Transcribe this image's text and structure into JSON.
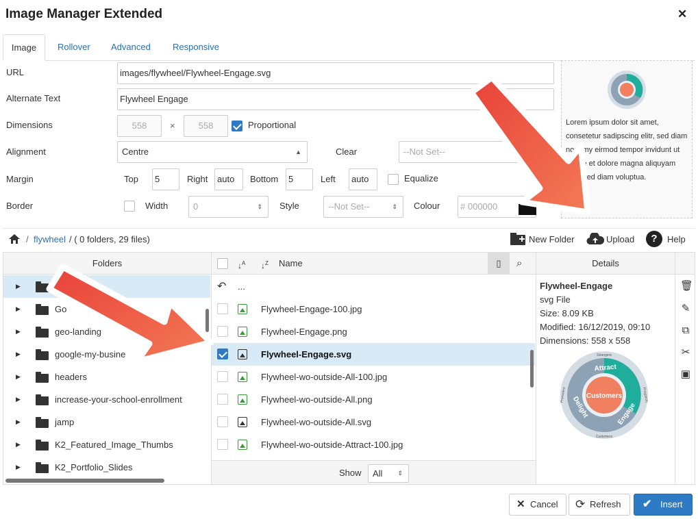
{
  "dialog": {
    "title": "Image Manager Extended",
    "close_icon": "close-icon"
  },
  "tabs": [
    {
      "label": "Image"
    },
    {
      "label": "Rollover"
    },
    {
      "label": "Advanced"
    },
    {
      "label": "Responsive"
    }
  ],
  "form": {
    "url_label": "URL",
    "url_value": "images/flywheel/Flywheel-Engage.svg",
    "alt_label": "Alternate Text",
    "alt_value": "Flywheel Engage",
    "dimensions_label": "Dimensions",
    "width_value": "558",
    "times": "×",
    "height_value": "558",
    "proportional_label": "Proportional",
    "alignment_label": "Alignment",
    "alignment_value": "Centre",
    "clear_label": "Clear",
    "clear_value": "--Not Set--",
    "margin_label": "Margin",
    "top_label": "Top",
    "top_value": "5",
    "right_label": "Right",
    "right_value": "auto",
    "bottom_label": "Bottom",
    "bottom_value": "5",
    "left_label": "Left",
    "left_value": "auto",
    "equalize_label": "Equalize",
    "border_label": "Border",
    "border_width_label": "Width",
    "border_width_value": "0",
    "style_label": "Style",
    "style_value": "--Not Set--",
    "colour_label": "Colour",
    "colour_placeholder": "000000",
    "hash": "#"
  },
  "preview": {
    "text": "Lorem ipsum dolor sit amet, consetetur sadipscing elitr, sed diam nonumy eirmod tempor invidunt ut labore et dolore magna aliquyam erat, sed diam voluptua."
  },
  "browser": {
    "breadcrumb_sep": "/",
    "breadcrumb_folder": "flywheel",
    "breadcrumb_info": "/ ( 0 folders, 29 files)",
    "new_folder": "New Folder",
    "upload": "Upload",
    "help": "Help",
    "folders_header": "Folders",
    "name_header": "Name",
    "details_header": "Details",
    "up_label": "...",
    "folders": [
      "",
      "Go",
      "geo-landing",
      "google-my-busine",
      "headers",
      "increase-your-school-enrollment",
      "jamp",
      "K2_Featured_Image_Thumbs",
      "K2_Portfolio_Slides"
    ],
    "files": [
      {
        "name": "Flywheel-Engage-100.jpg",
        "type": "image"
      },
      {
        "name": "Flywheel-Engage.png",
        "type": "image"
      },
      {
        "name": "Flywheel-Engage.svg",
        "type": "svg",
        "selected": true
      },
      {
        "name": "Flywheel-wo-outside-All-100.jpg",
        "type": "image"
      },
      {
        "name": "Flywheel-wo-outside-All.png",
        "type": "image"
      },
      {
        "name": "Flywheel-wo-outside-All.svg",
        "type": "svg"
      },
      {
        "name": "Flywheel-wo-outside-Attract-100.jpg",
        "type": "image"
      }
    ],
    "show_label": "Show",
    "show_value": "All"
  },
  "details": {
    "name": "Flywheel-Engage",
    "type": "svg File",
    "size": "Size: 8.09 KB",
    "modified": "Modified: 16/12/2019, 09:10",
    "dimensions": "Dimensions: 558 x 558"
  },
  "flywheel": {
    "center": "Customers",
    "attract": "Attract",
    "engage": "Engage",
    "delight": "Delight",
    "strangers": "Strangers",
    "prospects": "Prospects",
    "promoters": "Promoters",
    "customers": "Customers"
  },
  "footer": {
    "cancel": "Cancel",
    "refresh": "Refresh",
    "insert": "Insert"
  },
  "colors": {
    "accent": "#2d7bc4",
    "arrow": "#ee5a45",
    "teal": "#1fae9c",
    "orange": "#f08060"
  }
}
